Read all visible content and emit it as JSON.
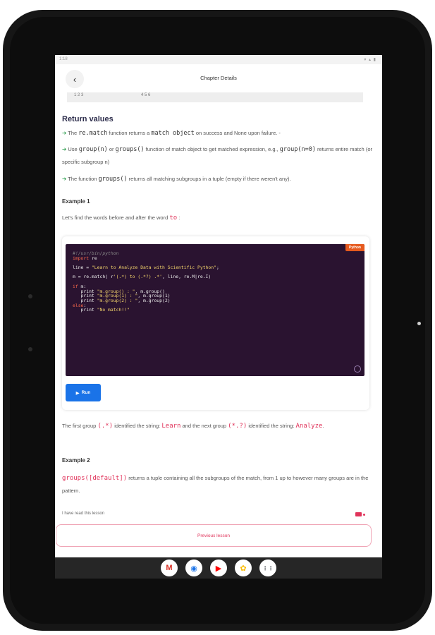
{
  "status_bar": {
    "time": "1:18",
    "icons": "▾ ▴ ▮"
  },
  "app_bar": {
    "title": "Chapter Details",
    "back_glyph": "‹"
  },
  "table_remnant": {
    "col1": "1 2 3",
    "col2": "4 5 6"
  },
  "return_values": {
    "heading": "Return values",
    "bullets": [
      {
        "p1": "The ",
        "code1": "re.match",
        "p2": " function returns a ",
        "code2": "match object",
        "p3": " on success and None upon failure. -"
      },
      {
        "p1": "Use ",
        "code1": "group(n)",
        "p2": " or ",
        "code2": "groups()",
        "p3": " function of match object to get matched expression, e.g., ",
        "code3": "group(n=0)",
        "p4": " returns entire match (or specific subgroup n)"
      },
      {
        "p1": "The function ",
        "code1": "groups()",
        "p2": " returns all matching subgroups in a tuple (empty if there weren't any)."
      }
    ]
  },
  "example1": {
    "heading": "Example 1",
    "intro_text": "Let's find the words before and after the word ",
    "intro_code": "to",
    "intro_end": ":"
  },
  "code": {
    "language": "Python",
    "lines": [
      {
        "kind": "comment",
        "text": "#!/usr/bin/python"
      },
      {
        "kind": "import",
        "kw": "import",
        "rest": " re"
      },
      {
        "kind": "blank"
      },
      {
        "kind": "assign",
        "pre": "line = ",
        "str": "\"Learn to Analyze Data with Scientific Python\"",
        "post": ";"
      },
      {
        "kind": "blank"
      },
      {
        "kind": "assign",
        "pre": "m = re.match( r",
        "str": "'(.*) to (.*?) .*'",
        "post": ", line, re.M|re.I)"
      },
      {
        "kind": "blank"
      },
      {
        "kind": "kwline",
        "kw": "if",
        "rest": " m:"
      },
      {
        "kind": "assign",
        "pre": "   print ",
        "str": "\"m.group() : \"",
        "post": ", m.group()"
      },
      {
        "kind": "assign",
        "pre": "   print ",
        "str": "\"m.group(1) : \"",
        "post": ", m.group(1)"
      },
      {
        "kind": "assign",
        "pre": "   print ",
        "str": "\"m.group(2) : \"",
        "post": ", m.group(2)"
      },
      {
        "kind": "kwline",
        "kw": "else",
        "rest": ":"
      },
      {
        "kind": "assign",
        "pre": "   print ",
        "str": "\"No match!!\"",
        "post": ""
      }
    ],
    "run_label": "Run",
    "run_glyph": "▶"
  },
  "result": {
    "p1": "The first group ",
    "c1": "(.*)",
    "p2": " identified the string: ",
    "c2": "Learn",
    "p3": " and the next group ",
    "c3": "(*.?)",
    "p4": " identified the string: ",
    "c4": "Analyze",
    "p5": "."
  },
  "example2": {
    "heading": "Example 2",
    "code": "groups([default])",
    "p1": " returns a tuple containing all the subgroups of the match, from 1 up to however many groups are in the pattern."
  },
  "footer": {
    "read_label": "I have read this lesson",
    "previous_label": "Previous lesson"
  },
  "dock": {
    "apps": [
      {
        "name": "gmail",
        "glyph": "M",
        "color": "#d93025"
      },
      {
        "name": "chrome",
        "glyph": "◉",
        "color": "#1a73e8"
      },
      {
        "name": "youtube",
        "glyph": "▶",
        "color": "#ff0000"
      },
      {
        "name": "photos",
        "glyph": "✿",
        "color": "#fbbc04"
      },
      {
        "name": "apps",
        "glyph": "⋮⋮",
        "color": "#5f6368"
      }
    ]
  }
}
